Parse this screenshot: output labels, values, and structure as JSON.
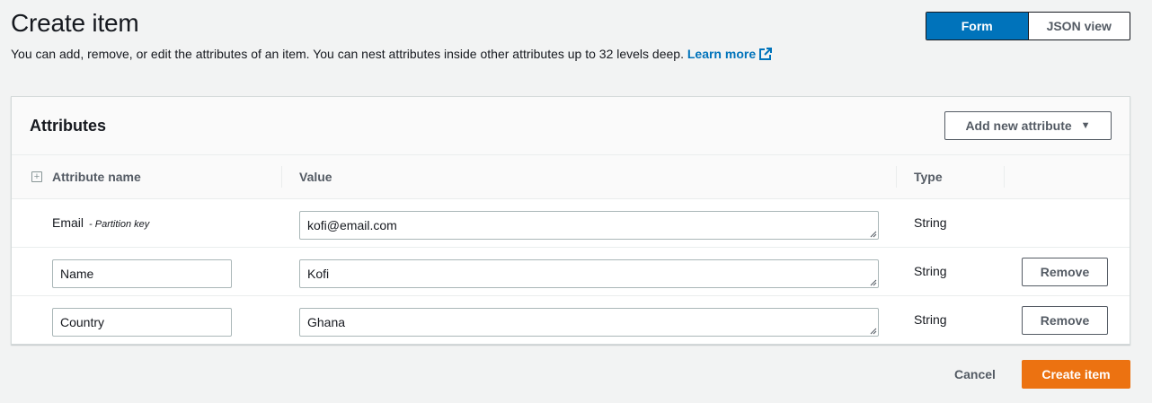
{
  "header": {
    "title": "Create item",
    "description": "You can add, remove, or edit the attributes of an item. You can nest attributes inside other attributes up to 32 levels deep.",
    "learn_more": "Learn more",
    "view_toggle": {
      "form": "Form",
      "json": "JSON view",
      "selected": "Form"
    }
  },
  "attributes": {
    "title": "Attributes",
    "add_button": "Add new attribute",
    "columns": {
      "name": "Attribute name",
      "value": "Value",
      "type": "Type"
    },
    "rows": [
      {
        "name": "Email",
        "note": "- Partition key",
        "value": "kofi@email.com",
        "type": "String"
      },
      {
        "name": "Name",
        "value": "Kofi",
        "type": "String",
        "remove": "Remove"
      },
      {
        "name": "Country",
        "value": "Ghana",
        "type": "String",
        "remove": "Remove"
      }
    ]
  },
  "footer": {
    "cancel": "Cancel",
    "create": "Create item"
  },
  "colors": {
    "primary": "#0073bb",
    "action": "#ec7211"
  }
}
